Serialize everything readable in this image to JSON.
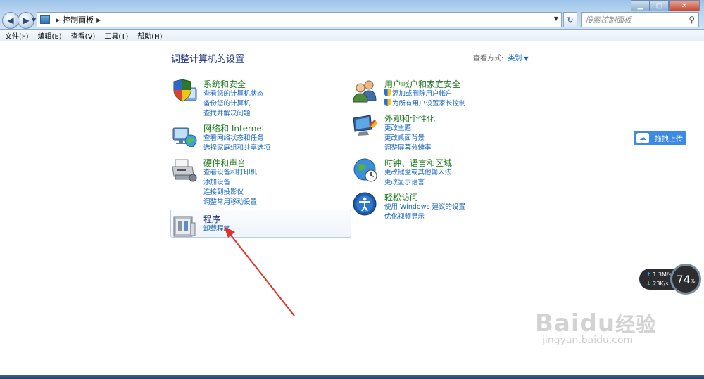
{
  "window": {
    "address": {
      "root_icon": "control-panel-icon",
      "segments": [
        "控制面板"
      ]
    },
    "search_placeholder": "搜索控制面板",
    "controls": [
      "minimize",
      "maximize",
      "close"
    ]
  },
  "menu": [
    "文件(F)",
    "编辑(E)",
    "查看(V)",
    "工具(T)",
    "帮助(H)"
  ],
  "content": {
    "title": "调整计算机的设置",
    "view_by_label": "查看方式:",
    "view_by_value": "类别"
  },
  "categories": {
    "system": {
      "icon": "shield-computer-icon",
      "title": "系统和安全",
      "links": [
        "查看您的计算机状态",
        "备份您的计算机",
        "查找并解决问题"
      ]
    },
    "network": {
      "icon": "network-globe-icon",
      "title": "网络和 Internet",
      "links": [
        "查看网络状态和任务",
        "选择家庭组和共享选项"
      ]
    },
    "hardware": {
      "icon": "printer-icon",
      "title": "硬件和声音",
      "links": [
        "查看设备和打印机",
        "添加设备",
        "连接到投影仪",
        "调整常用移动设置"
      ]
    },
    "programs": {
      "icon": "programs-icon",
      "title": "程序",
      "links": [
        "卸载程序"
      ]
    },
    "users": {
      "icon": "users-icon",
      "title": "用户帐户和家庭安全",
      "links": [
        "添加或删除用户帐户",
        "为所有用户设置家长控制"
      ]
    },
    "appearance": {
      "icon": "display-icon",
      "title": "外观和个性化",
      "links": [
        "更改主题",
        "更改桌面背景",
        "调整屏幕分辨率"
      ]
    },
    "clock": {
      "icon": "globe-clock-icon",
      "title": "时钟、语言和区域",
      "links": [
        "更改键盘或其他输入法",
        "更改显示语言"
      ]
    },
    "ease": {
      "icon": "ease-of-access-icon",
      "title": "轻松访问",
      "links": [
        "使用 Windows 建议的设置",
        "优化视频显示"
      ]
    }
  },
  "overlay": {
    "upload_label": "拖拽上传",
    "net_up": "1.3M/s",
    "net_down": "23K/s",
    "gauge_value": "74",
    "gauge_unit": "%",
    "watermark_brand": "Baidu",
    "watermark_cn": "经验",
    "watermark_url": "jingyan.baidu.com"
  },
  "colors": {
    "accent": "#1565c0",
    "category_title": "#1e7d1e",
    "arrow": "#e0322c"
  }
}
